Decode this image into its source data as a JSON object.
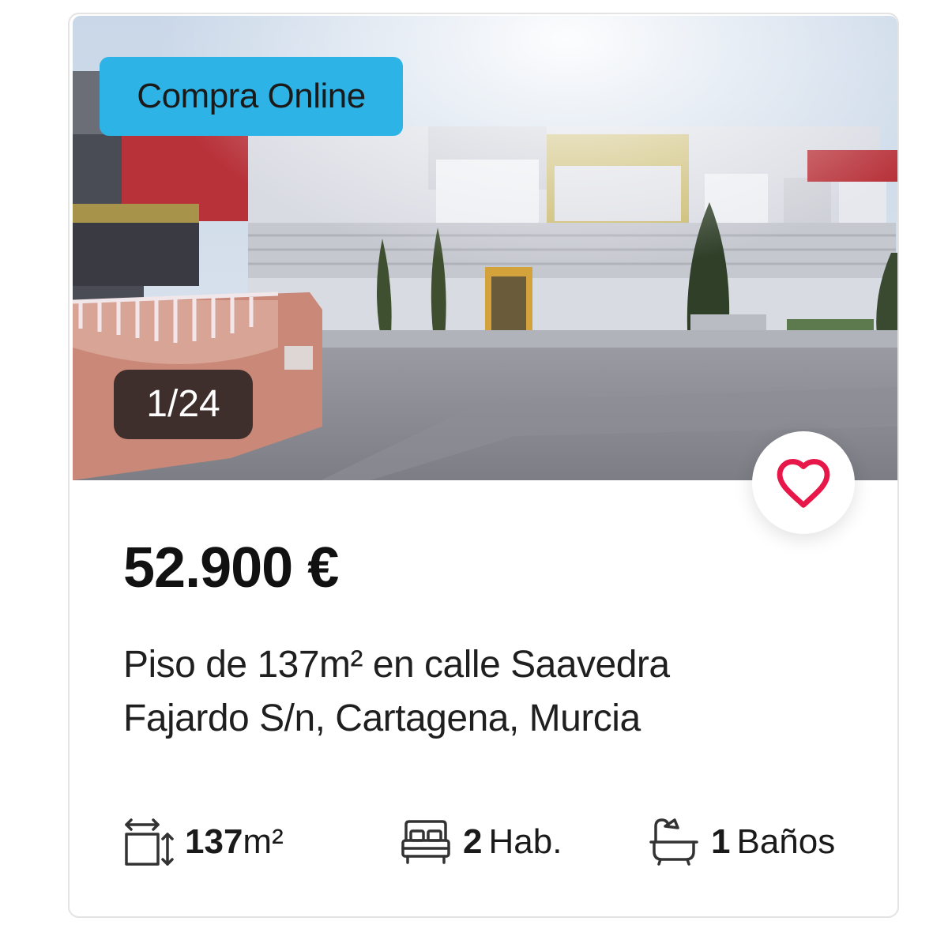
{
  "listing": {
    "badge": "Compra Online",
    "photo_counter": "1/24",
    "price": "52.900 €",
    "title": "Piso de 137m² en calle Saavedra Fajardo S/n, Cartagena, Murcia",
    "favorite_icon": "heart-icon"
  },
  "features": {
    "area": {
      "icon": "area-icon",
      "value": "137",
      "unit": "m²"
    },
    "rooms": {
      "icon": "bed-icon",
      "value": "2",
      "unit": "Hab."
    },
    "baths": {
      "icon": "bathtub-icon",
      "value": "1",
      "unit": "Baños"
    }
  },
  "colors": {
    "badge_bg": "#2db3e6",
    "heart": "#e8174a",
    "text": "#1a1a1a"
  }
}
